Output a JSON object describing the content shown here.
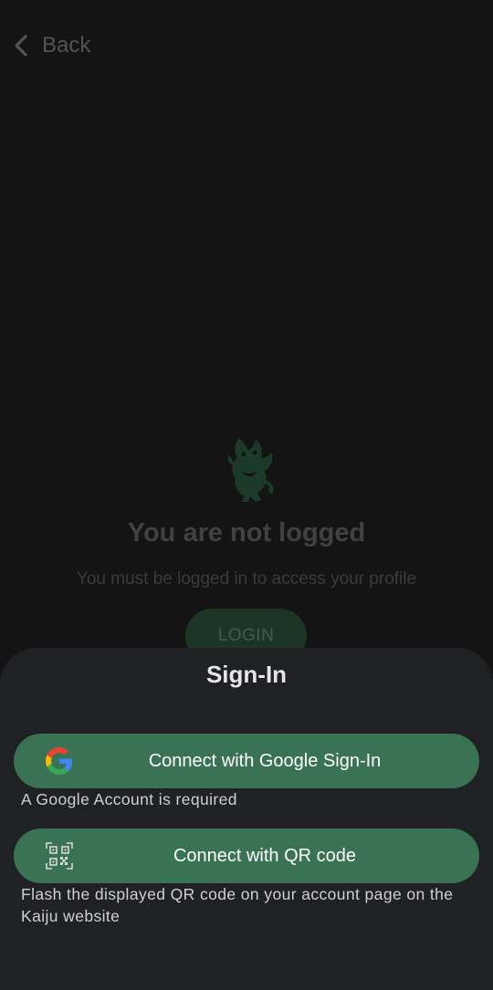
{
  "header": {
    "back_label": "Back"
  },
  "profile": {
    "title": "You are not logged",
    "subtitle": "You must be logged in to access your profile",
    "login_label": "LOGIN"
  },
  "sheet": {
    "title": "Sign-In",
    "google": {
      "label": "Connect with Google Sign-In",
      "caption": "A Google Account is required",
      "icon": "google-g-icon"
    },
    "qr": {
      "label": "Connect with QR code",
      "caption": "Flash the displayed QR code on your account page on the Kaiju website",
      "icon": "qr-code-icon"
    }
  },
  "colors": {
    "background": "#141414",
    "sheet": "#202124",
    "button_green": "#3a7254",
    "login_dim": "#1d3526"
  }
}
